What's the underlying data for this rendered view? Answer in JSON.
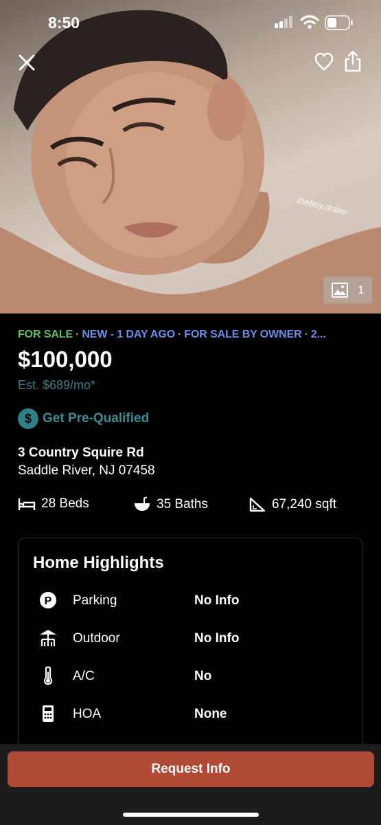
{
  "status_bar": {
    "time": "8:50"
  },
  "photo": {
    "watermark": "theboy.drake",
    "count": "1"
  },
  "listing": {
    "tags": [
      "FOR SALE",
      "NEW - 1 DAY AGO",
      "FOR SALE BY OWNER",
      "2..."
    ],
    "price": "$100,000",
    "est_payment": "Est. $689/mo*",
    "prequalify_icon": "$",
    "prequalify_label": "Get Pre-Qualified",
    "address_line1": "3 Country Squire Rd",
    "address_line2": "Saddle River, NJ 07458",
    "facts": {
      "beds": "28 Beds",
      "baths": "35 Baths",
      "sqft": "67,240 sqft"
    }
  },
  "highlights": {
    "title": "Home Highlights",
    "rows": [
      {
        "icon": "parking-icon",
        "label": "Parking",
        "value": "No Info"
      },
      {
        "icon": "outdoor-icon",
        "label": "Outdoor",
        "value": "No Info"
      },
      {
        "icon": "thermometer-icon",
        "label": "A/C",
        "value": "No"
      },
      {
        "icon": "hoa-icon",
        "label": "HOA",
        "value": "None"
      }
    ]
  },
  "cta": {
    "request_label": "Request Info"
  },
  "colors": {
    "for_sale": "#5fbf6b",
    "tag_blue": "#6b8ee6",
    "accent_teal": "#3a8b93",
    "cta": "#b04a35"
  }
}
